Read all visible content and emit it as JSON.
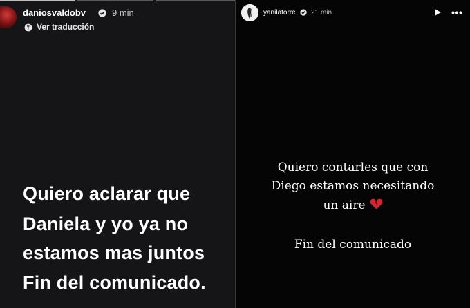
{
  "left_story": {
    "username": "daniosvaldobv",
    "time": "9 min",
    "translate_label": "Ver traducción",
    "lines": [
      "Quiero aclarar que",
      "Daniela y yo ya no",
      "estamos mas juntos",
      "Fin del comunicado."
    ],
    "progress_segments": 3,
    "progress_filled": 1
  },
  "right_story": {
    "username": "yanilatorre",
    "time": "21 min",
    "lines": [
      "Quiero contarles que con",
      "Diego estamos necesitando",
      "un aire"
    ],
    "closing": "Fin del comunicado"
  },
  "colors": {
    "left_background": "#151517",
    "right_background": "#050505",
    "text": "#ffffff",
    "heart": "#d8242c"
  },
  "icons": {
    "verified": "verified-badge-icon",
    "translate": "translate-icon",
    "play": "play-icon",
    "more": "more-options-icon",
    "heart": "broken-heart-icon"
  }
}
